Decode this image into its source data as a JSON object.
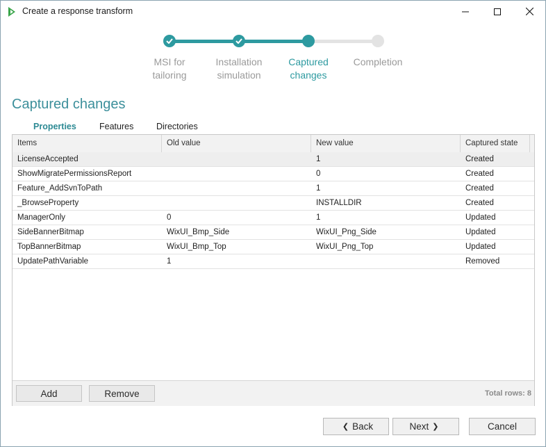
{
  "window": {
    "title": "Create a response transform"
  },
  "stepper": {
    "steps": [
      {
        "label_line1": "MSI for",
        "label_line2": "tailoring",
        "state": "done"
      },
      {
        "label_line1": "Installation",
        "label_line2": "simulation",
        "state": "done"
      },
      {
        "label_line1": "Captured",
        "label_line2": "changes",
        "state": "current"
      },
      {
        "label_line1": "Completion",
        "label_line2": "",
        "state": "todo"
      }
    ]
  },
  "page": {
    "heading": "Captured changes"
  },
  "tabs": [
    {
      "label": "Properties",
      "active": true
    },
    {
      "label": "Features",
      "active": false
    },
    {
      "label": "Directories",
      "active": false
    }
  ],
  "table": {
    "columns": [
      "Items",
      "Old value",
      "New value",
      "Captured state"
    ],
    "rows": [
      [
        "LicenseAccepted",
        "",
        "1",
        "Created"
      ],
      [
        "ShowMigratePermissionsReport",
        "",
        "0",
        "Created"
      ],
      [
        "Feature_AddSvnToPath",
        "",
        "1",
        "Created"
      ],
      [
        "_BrowseProperty",
        "",
        "INSTALLDIR",
        "Created"
      ],
      [
        "ManagerOnly",
        "0",
        "1",
        "Updated"
      ],
      [
        "SideBannerBitmap",
        "WixUI_Bmp_Side",
        "WixUI_Png_Side",
        "Updated"
      ],
      [
        "TopBannerBitmap",
        "WixUI_Bmp_Top",
        "WixUI_Png_Top",
        "Updated"
      ],
      [
        "UpdatePathVariable",
        "1",
        "",
        "Removed"
      ]
    ],
    "selected_row": 0,
    "add_label": "Add",
    "remove_label": "Remove",
    "total_rows": "Total rows: 8"
  },
  "nav": {
    "back_label": "Back",
    "next_label": "Next",
    "cancel_label": "Cancel"
  },
  "colors": {
    "accent": "#2d9aa0",
    "inactive": "#e3e3e3"
  }
}
